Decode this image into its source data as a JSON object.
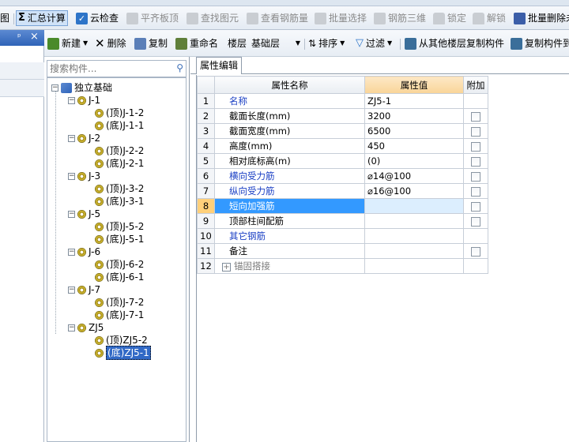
{
  "toolbar1": {
    "items": [
      {
        "label": "图",
        "icon": "sum-icon"
      },
      {
        "label": "汇总计算",
        "icon": "sigma-icon"
      },
      {
        "label": "云检查",
        "icon": "cloud-check-icon"
      },
      {
        "label": "平齐板顶",
        "icon": "align-slab-icon"
      },
      {
        "label": "查找图元",
        "icon": "find-element-icon"
      },
      {
        "label": "查看钢筋量",
        "icon": "view-rebar-icon"
      },
      {
        "label": "批量选择",
        "icon": "batch-select-icon"
      },
      {
        "label": "钢筋三维",
        "icon": "rebar-3d-icon"
      },
      {
        "label": "锁定",
        "icon": "lock-icon"
      },
      {
        "label": "解锁",
        "icon": "unlock-icon"
      },
      {
        "label": "批量删除未",
        "icon": "batch-delete-icon"
      }
    ]
  },
  "left_dock": {
    "pin": "ᵖ",
    "close": "×"
  },
  "toolbar2": {
    "new_label": "新建",
    "delete_label": "删除",
    "copy_label": "复制",
    "rename_label": "重命名",
    "floor_label": "楼层",
    "floor_value": "基础层",
    "sort_label": "排序",
    "filter_label": "过滤",
    "copy_from_floor_label": "从其他楼层复制构件",
    "copy_component_label": "复制构件到"
  },
  "search": {
    "placeholder": "搜索构件..."
  },
  "tree": {
    "root": "独立基础",
    "groups": [
      {
        "name": "J-1",
        "children": [
          "(顶)J-1-2",
          "(底)J-1-1"
        ]
      },
      {
        "name": "J-2",
        "children": [
          "(顶)J-2-2",
          "(底)J-2-1"
        ]
      },
      {
        "name": "J-3",
        "children": [
          "(顶)J-3-2",
          "(底)J-3-1"
        ]
      },
      {
        "name": "J-5",
        "children": [
          "(顶)J-5-2",
          "(底)J-5-1"
        ]
      },
      {
        "name": "J-6",
        "children": [
          "(顶)J-6-2",
          "(底)J-6-1"
        ]
      },
      {
        "name": "J-7",
        "children": [
          "(顶)J-7-2",
          "(底)J-7-1"
        ]
      },
      {
        "name": "ZJ5",
        "children": [
          "(顶)ZJ5-2",
          "(底)ZJ5-1"
        ]
      }
    ],
    "selected": "(底)ZJ5-1"
  },
  "tab": {
    "label": "属性编辑"
  },
  "grid": {
    "headers": {
      "name": "属性名称",
      "value": "属性值",
      "extra": "附加"
    },
    "rows": [
      {
        "n": "1",
        "name": "名称",
        "value": "ZJ5-1",
        "blue": true,
        "check": false
      },
      {
        "n": "2",
        "name": "截面长度(mm)",
        "value": "3200",
        "blue": false,
        "check": true
      },
      {
        "n": "3",
        "name": "截面宽度(mm)",
        "value": "6500",
        "blue": false,
        "check": true
      },
      {
        "n": "4",
        "name": "高度(mm)",
        "value": "450",
        "blue": false,
        "check": true
      },
      {
        "n": "5",
        "name": "相对底标高(m)",
        "value": "(0)",
        "blue": false,
        "check": true
      },
      {
        "n": "6",
        "name": "横向受力筋",
        "value": "⌀14@100",
        "blue": true,
        "check": true
      },
      {
        "n": "7",
        "name": "纵向受力筋",
        "value": "⌀16@100",
        "blue": true,
        "check": true
      },
      {
        "n": "8",
        "name": "短向加强筋",
        "value": "",
        "blue": true,
        "check": true
      },
      {
        "n": "9",
        "name": "顶部柱间配筋",
        "value": "",
        "blue": false,
        "check": true
      },
      {
        "n": "10",
        "name": "其它钢筋",
        "value": "",
        "blue": true,
        "check": false
      },
      {
        "n": "11",
        "name": "备注",
        "value": "",
        "blue": false,
        "check": true
      },
      {
        "n": "12",
        "name": "锚固搭接",
        "value": "",
        "blue": false,
        "check": false
      }
    ],
    "selected_row": "8"
  }
}
